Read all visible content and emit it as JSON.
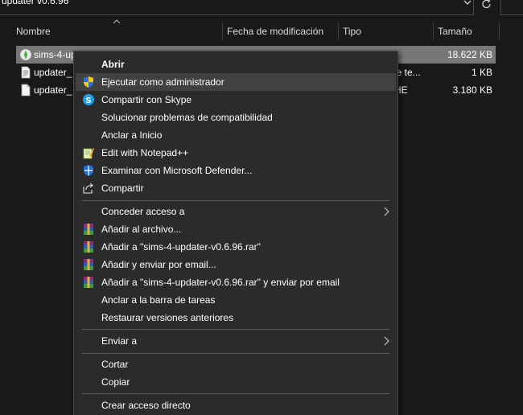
{
  "address": {
    "path_text": "updater v0.6.96"
  },
  "columns": {
    "name": "Nombre",
    "modified": "Fecha de modificación",
    "type": "Tipo",
    "size": "Tamaño"
  },
  "files": [
    {
      "name": "sims-4-up",
      "type": "",
      "size": "18.622 KB",
      "selected": true,
      "icon": "sims-app-icon"
    },
    {
      "name": "updater_",
      "type": "le te...",
      "size": "1 KB",
      "selected": false,
      "icon": "text-file-icon"
    },
    {
      "name": "updater_",
      "type": "HE",
      "size": "3.180 KB",
      "selected": false,
      "icon": "file-icon"
    }
  ],
  "menu": {
    "items": [
      {
        "label": "Abrir",
        "bold": true,
        "icon": ""
      },
      {
        "label": "Ejecutar como administrador",
        "icon": "uac-shield-icon",
        "hover": true
      },
      {
        "label": "Compartir con Skype",
        "icon": "skype-icon"
      },
      {
        "label": "Solucionar problemas de compatibilidad",
        "icon": ""
      },
      {
        "label": "Anclar a Inicio",
        "icon": ""
      },
      {
        "label": "Edit with Notepad++",
        "icon": "notepad-plus-plus-icon"
      },
      {
        "label": "Examinar con Microsoft Defender...",
        "icon": "defender-shield-icon"
      },
      {
        "label": "Compartir",
        "icon": "share-icon"
      },
      {
        "label": "Conceder acceso a",
        "icon": "",
        "submenu": true
      },
      {
        "label": "Añadir al archivo...",
        "icon": "winrar-icon"
      },
      {
        "label": "Añadir a \"sims-4-updater-v0.6.96.rar\"",
        "icon": "winrar-icon"
      },
      {
        "label": "Añadir y enviar por email...",
        "icon": "winrar-icon"
      },
      {
        "label": "Añadir a \"sims-4-updater-v0.6.96.rar\" y enviar por email",
        "icon": "winrar-icon"
      },
      {
        "label": "Anclar a la barra de tareas",
        "icon": ""
      },
      {
        "label": "Restaurar versiones anteriores",
        "icon": ""
      },
      {
        "label": "Enviar a",
        "icon": "",
        "submenu": true
      },
      {
        "label": "Cortar",
        "icon": ""
      },
      {
        "label": "Copiar",
        "icon": ""
      },
      {
        "label": "Crear acceso directo",
        "icon": ""
      }
    ]
  }
}
